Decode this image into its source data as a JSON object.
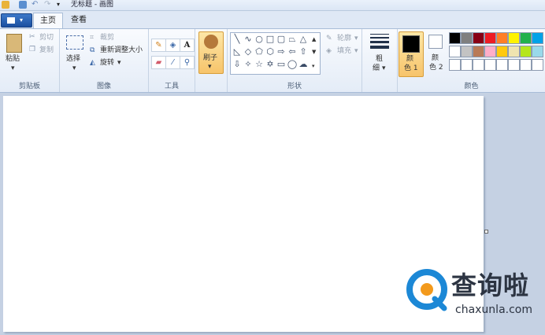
{
  "window": {
    "title": "无标题 - 画图"
  },
  "tabs": [
    {
      "label": "主页"
    },
    {
      "label": "查看"
    }
  ],
  "clipboard": {
    "paste": "粘贴",
    "cut": "剪切",
    "copy": "复制",
    "label": "剪贴板"
  },
  "image": {
    "select": "选择",
    "crop": "裁剪",
    "resize": "重新调整大小",
    "rotate": "旋转",
    "label": "图像"
  },
  "tools": {
    "text": "A",
    "label": "工具"
  },
  "brushes": {
    "label": "刷子"
  },
  "shapes": {
    "outline": "轮廓",
    "fill": "填充",
    "label": "形状"
  },
  "size": {
    "label1": "粗",
    "label2": "细"
  },
  "colors": {
    "color1_a": "颜",
    "color1_b": "色 1",
    "color2_a": "颜",
    "color2_b": "色 2",
    "label": "颜色",
    "color1": "#000000",
    "color2": "#ffffff",
    "palette_row1": [
      "#000000",
      "#7f7f7f",
      "#880015",
      "#ed1c24",
      "#ff7f27",
      "#fff200",
      "#22b14c",
      "#00a2e8"
    ],
    "palette_row2": [
      "#ffffff",
      "#c3c3c3",
      "#b97a57",
      "#ffaec9",
      "#ffc90e",
      "#efe4b0",
      "#b5e61d",
      "#99d9ea"
    ]
  },
  "watermark": {
    "text": "查询啦",
    "url": "chaxunla.com"
  }
}
